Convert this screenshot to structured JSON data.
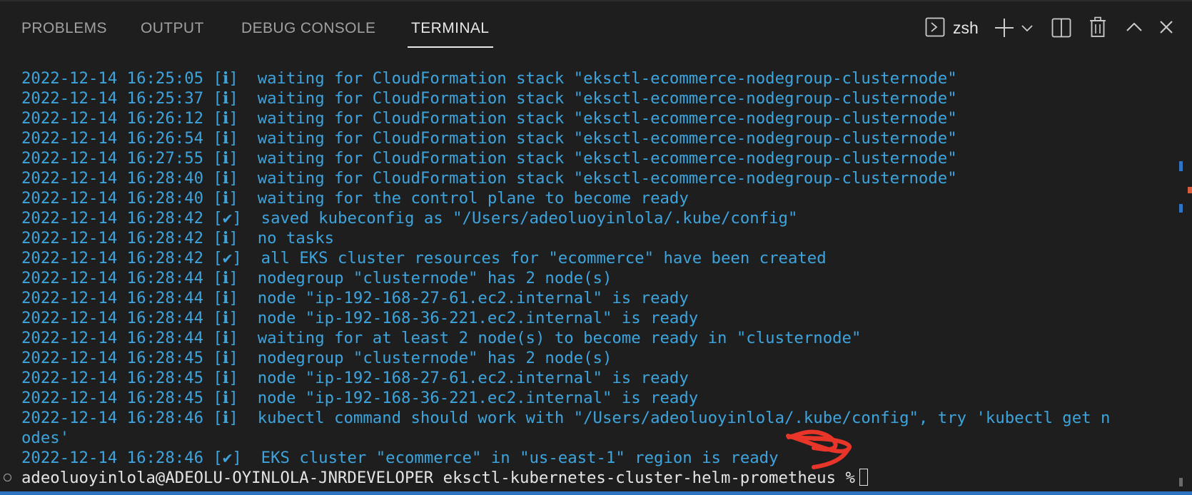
{
  "tabs": [
    {
      "label": "PROBLEMS"
    },
    {
      "label": "OUTPUT"
    },
    {
      "label": "DEBUG CONSOLE"
    },
    {
      "label": "TERMINAL",
      "active": true
    }
  ],
  "toolbar": {
    "shell_icon": "terminal-icon",
    "shell_label": "zsh",
    "new_terminal_icon": "plus-icon",
    "dropdown_icon": "chevron-down-icon",
    "split_icon": "split-terminal-icon",
    "trash_icon": "trash-icon",
    "maximize_icon": "chevron-up-icon",
    "close_icon": "close-icon"
  },
  "terminal": {
    "lines": [
      {
        "ts": "2022-12-14 16:25:05",
        "level": "[ℹ]",
        "msg": "waiting for CloudFormation stack \"eksctl-ecommerce-nodegroup-clusternode\""
      },
      {
        "ts": "2022-12-14 16:25:37",
        "level": "[ℹ]",
        "msg": "waiting for CloudFormation stack \"eksctl-ecommerce-nodegroup-clusternode\""
      },
      {
        "ts": "2022-12-14 16:26:12",
        "level": "[ℹ]",
        "msg": "waiting for CloudFormation stack \"eksctl-ecommerce-nodegroup-clusternode\""
      },
      {
        "ts": "2022-12-14 16:26:54",
        "level": "[ℹ]",
        "msg": "waiting for CloudFormation stack \"eksctl-ecommerce-nodegroup-clusternode\""
      },
      {
        "ts": "2022-12-14 16:27:55",
        "level": "[ℹ]",
        "msg": "waiting for CloudFormation stack \"eksctl-ecommerce-nodegroup-clusternode\""
      },
      {
        "ts": "2022-12-14 16:28:40",
        "level": "[ℹ]",
        "msg": "waiting for CloudFormation stack \"eksctl-ecommerce-nodegroup-clusternode\""
      },
      {
        "ts": "2022-12-14 16:28:40",
        "level": "[ℹ]",
        "msg": "waiting for the control plane to become ready"
      },
      {
        "ts": "2022-12-14 16:28:42",
        "level": "[✔]",
        "msg": "saved kubeconfig as \"/Users/adeoluoyinlola/.kube/config\""
      },
      {
        "ts": "2022-12-14 16:28:42",
        "level": "[ℹ]",
        "msg": "no tasks"
      },
      {
        "ts": "2022-12-14 16:28:42",
        "level": "[✔]",
        "msg": "all EKS cluster resources for \"ecommerce\" have been created"
      },
      {
        "ts": "2022-12-14 16:28:44",
        "level": "[ℹ]",
        "msg": "nodegroup \"clusternode\" has 2 node(s)"
      },
      {
        "ts": "2022-12-14 16:28:44",
        "level": "[ℹ]",
        "msg": "node \"ip-192-168-27-61.ec2.internal\" is ready"
      },
      {
        "ts": "2022-12-14 16:28:44",
        "level": "[ℹ]",
        "msg": "node \"ip-192-168-36-221.ec2.internal\" is ready"
      },
      {
        "ts": "2022-12-14 16:28:44",
        "level": "[ℹ]",
        "msg": "waiting for at least 2 node(s) to become ready in \"clusternode\""
      },
      {
        "ts": "2022-12-14 16:28:45",
        "level": "[ℹ]",
        "msg": "nodegroup \"clusternode\" has 2 node(s)"
      },
      {
        "ts": "2022-12-14 16:28:45",
        "level": "[ℹ]",
        "msg": "node \"ip-192-168-27-61.ec2.internal\" is ready"
      },
      {
        "ts": "2022-12-14 16:28:45",
        "level": "[ℹ]",
        "msg": "node \"ip-192-168-36-221.ec2.internal\" is ready"
      },
      {
        "ts": "2022-12-14 16:28:46",
        "level": "[ℹ]",
        "msg": "kubectl command should work with \"/Users/adeoluoyinlola/.kube/config\", try 'kubectl get n"
      },
      {
        "ts": "",
        "level": "",
        "msg": "odes'",
        "continuation": true
      },
      {
        "ts": "2022-12-14 16:28:46",
        "level": "[✔]",
        "msg": "EKS cluster \"ecommerce\" in \"us-east-1\" region is ready"
      }
    ],
    "prompt": "adeoluoyinlola@ADEOLU-OYINLOLA-JNRDEVELOPER eksctl-kubernetes-cluster-helm-prometheus %",
    "colors": {
      "text": "#3ea4dd",
      "prompt": "#e5e5e5",
      "background": "#1e1e1e",
      "annotation": "#e8352a",
      "status_bar": "#2f73c4"
    }
  }
}
